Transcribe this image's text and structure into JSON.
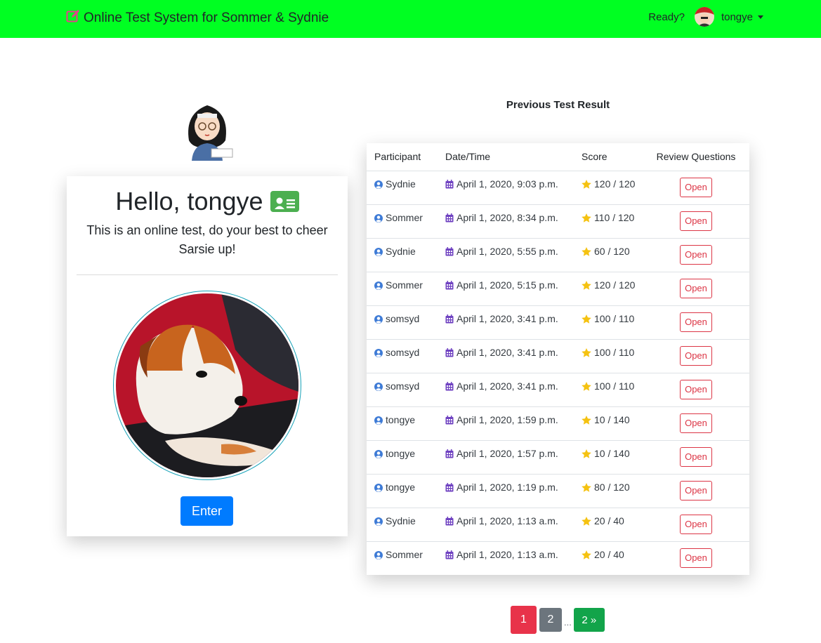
{
  "navbar": {
    "brand": "Online Test System for Sommer & Sydnie",
    "ready_text": "Ready?",
    "username": "tongye"
  },
  "welcome": {
    "greeting": "Hello, tongye",
    "message": "This is an online test, do your best to cheer Sarsie up!",
    "enter_label": "Enter"
  },
  "results": {
    "title": "Previous Test Result",
    "headers": [
      "Participant",
      "Date/Time",
      "Score",
      "Review Questions"
    ],
    "open_label": "Open",
    "rows": [
      {
        "participant": "Sydnie",
        "datetime": "April 1, 2020, 9:03 p.m.",
        "score": "120 / 120"
      },
      {
        "participant": "Sommer",
        "datetime": "April 1, 2020, 8:34 p.m.",
        "score": "110 / 120"
      },
      {
        "participant": "Sydnie",
        "datetime": "April 1, 2020, 5:55 p.m.",
        "score": "60 / 120"
      },
      {
        "participant": "Sommer",
        "datetime": "April 1, 2020, 5:15 p.m.",
        "score": "120 / 120"
      },
      {
        "participant": "somsyd",
        "datetime": "April 1, 2020, 3:41 p.m.",
        "score": "100 / 110"
      },
      {
        "participant": "somsyd",
        "datetime": "April 1, 2020, 3:41 p.m.",
        "score": "100 / 110"
      },
      {
        "participant": "somsyd",
        "datetime": "April 1, 2020, 3:41 p.m.",
        "score": "100 / 110"
      },
      {
        "participant": "tongye",
        "datetime": "April 1, 2020, 1:59 p.m.",
        "score": "10 / 140"
      },
      {
        "participant": "tongye",
        "datetime": "April 1, 2020, 1:57 p.m.",
        "score": "10 / 140"
      },
      {
        "participant": "tongye",
        "datetime": "April 1, 2020, 1:19 p.m.",
        "score": "80 / 120"
      },
      {
        "participant": "Sydnie",
        "datetime": "April 1, 2020, 1:13 a.m.",
        "score": "20 / 40"
      },
      {
        "participant": "Sommer",
        "datetime": "April 1, 2020, 1:13 a.m.",
        "score": "20 / 40"
      }
    ]
  },
  "pagination": {
    "current": "1",
    "page2": "2",
    "dots": "...",
    "last": "2 »"
  },
  "colors": {
    "navbar": "#00ff22",
    "primary": "#007bff",
    "danger": "#dc3545",
    "success": "#12a44a",
    "secondary": "#6c757d"
  },
  "icons": {
    "brand": "edit-icon",
    "participant": "user-circle-icon",
    "date": "calendar-icon",
    "score": "star-icon",
    "greeting": "id-card-icon"
  }
}
